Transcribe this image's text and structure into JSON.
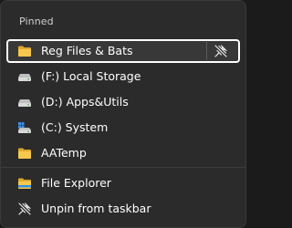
{
  "jumplist": {
    "section_title": "Pinned",
    "pinned": [
      {
        "label": "Reg Files & Bats",
        "icon": "folder-icon"
      },
      {
        "label": "(F:) Local Storage",
        "icon": "drive-icon"
      },
      {
        "label": "(D:) Apps&Utils",
        "icon": "drive-icon"
      },
      {
        "label": "(C:) System",
        "icon": "system-drive-icon"
      },
      {
        "label": "AATemp",
        "icon": "folder-icon"
      }
    ],
    "tasks": [
      {
        "label": "File Explorer",
        "icon": "file-explorer-icon"
      },
      {
        "label": "Unpin from taskbar",
        "icon": "unpin-icon"
      }
    ],
    "selected_item": "Reg Files & Bats",
    "unpin_button_icon": "unpin-icon"
  },
  "colors": {
    "background": "#2b2b2b",
    "text": "#ffffff",
    "folder": "#f3c14b",
    "drive": "#cfcfcf",
    "selection_outline": "#ffffff"
  }
}
